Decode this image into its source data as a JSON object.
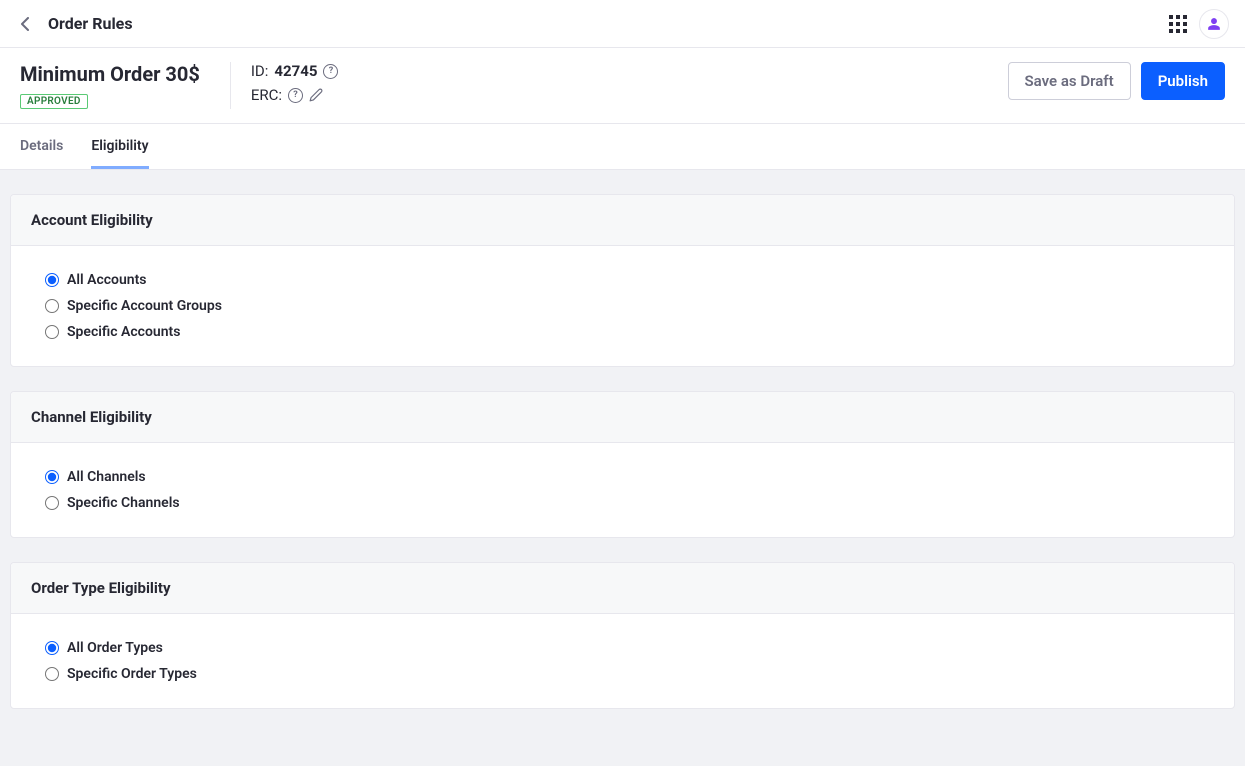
{
  "topbar": {
    "title": "Order Rules"
  },
  "header": {
    "title": "Minimum Order 30$",
    "status": "APPROVED",
    "meta": {
      "id_label": "ID:",
      "id_value": "42745",
      "erc_label": "ERC:"
    },
    "buttons": {
      "draft": "Save as Draft",
      "publish": "Publish"
    }
  },
  "tabs": {
    "details": "Details",
    "eligibility": "Eligibility"
  },
  "sections": {
    "account": {
      "title": "Account Eligibility",
      "options": {
        "all": "All Accounts",
        "groups": "Specific Account Groups",
        "specific": "Specific Accounts"
      }
    },
    "channel": {
      "title": "Channel Eligibility",
      "options": {
        "all": "All Channels",
        "specific": "Specific Channels"
      }
    },
    "orderType": {
      "title": "Order Type Eligibility",
      "options": {
        "all": "All Order Types",
        "specific": "Specific Order Types"
      }
    }
  }
}
